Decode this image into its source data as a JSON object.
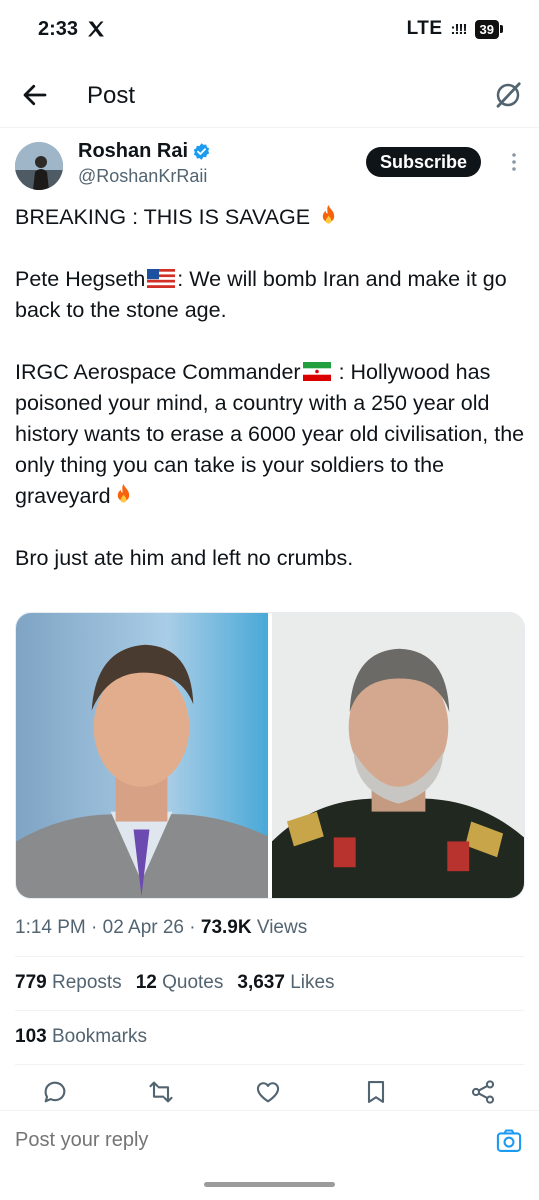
{
  "status_bar": {
    "time": "2:33",
    "network": "LTE",
    "signal": ":!!!",
    "battery": "39"
  },
  "header": {
    "title": "Post"
  },
  "author": {
    "name": "Roshan Rai",
    "handle": "@RoshanKrRaii",
    "subscribe_label": "Subscribe"
  },
  "post": {
    "line1": "BREAKING : THIS IS SAVAGE",
    "line2a": "Pete Hegseth",
    "line2b": ": We will bomb Iran and make it go back to the stone age.",
    "line3a": "IRGC Aerospace Commander",
    "line3b": " : Hollywood has poisoned your mind, a country with a 250 year old history wants to erase a 6000 year old civilisation, the only thing you can take is your soldiers to the graveyard",
    "line4": "Bro just ate him and left no crumbs."
  },
  "meta": {
    "time": "1:14 PM",
    "date": "02 Apr 26",
    "views_count": "73.9K",
    "views_label": "Views"
  },
  "stats": {
    "reposts_count": "779",
    "reposts_label": "Reposts",
    "quotes_count": "12",
    "quotes_label": "Quotes",
    "likes_count": "3,637",
    "likes_label": "Likes",
    "bookmarks_count": "103",
    "bookmarks_label": "Bookmarks"
  },
  "actions": [
    "reply-icon",
    "repost-icon",
    "like-icon",
    "bookmark-icon",
    "share-icon"
  ],
  "reply": {
    "placeholder": "Post your reply"
  },
  "colors": {
    "text": "#0f1419",
    "secondary": "#536471",
    "accent": "#1d9bf0",
    "fire": "#f7630c"
  }
}
